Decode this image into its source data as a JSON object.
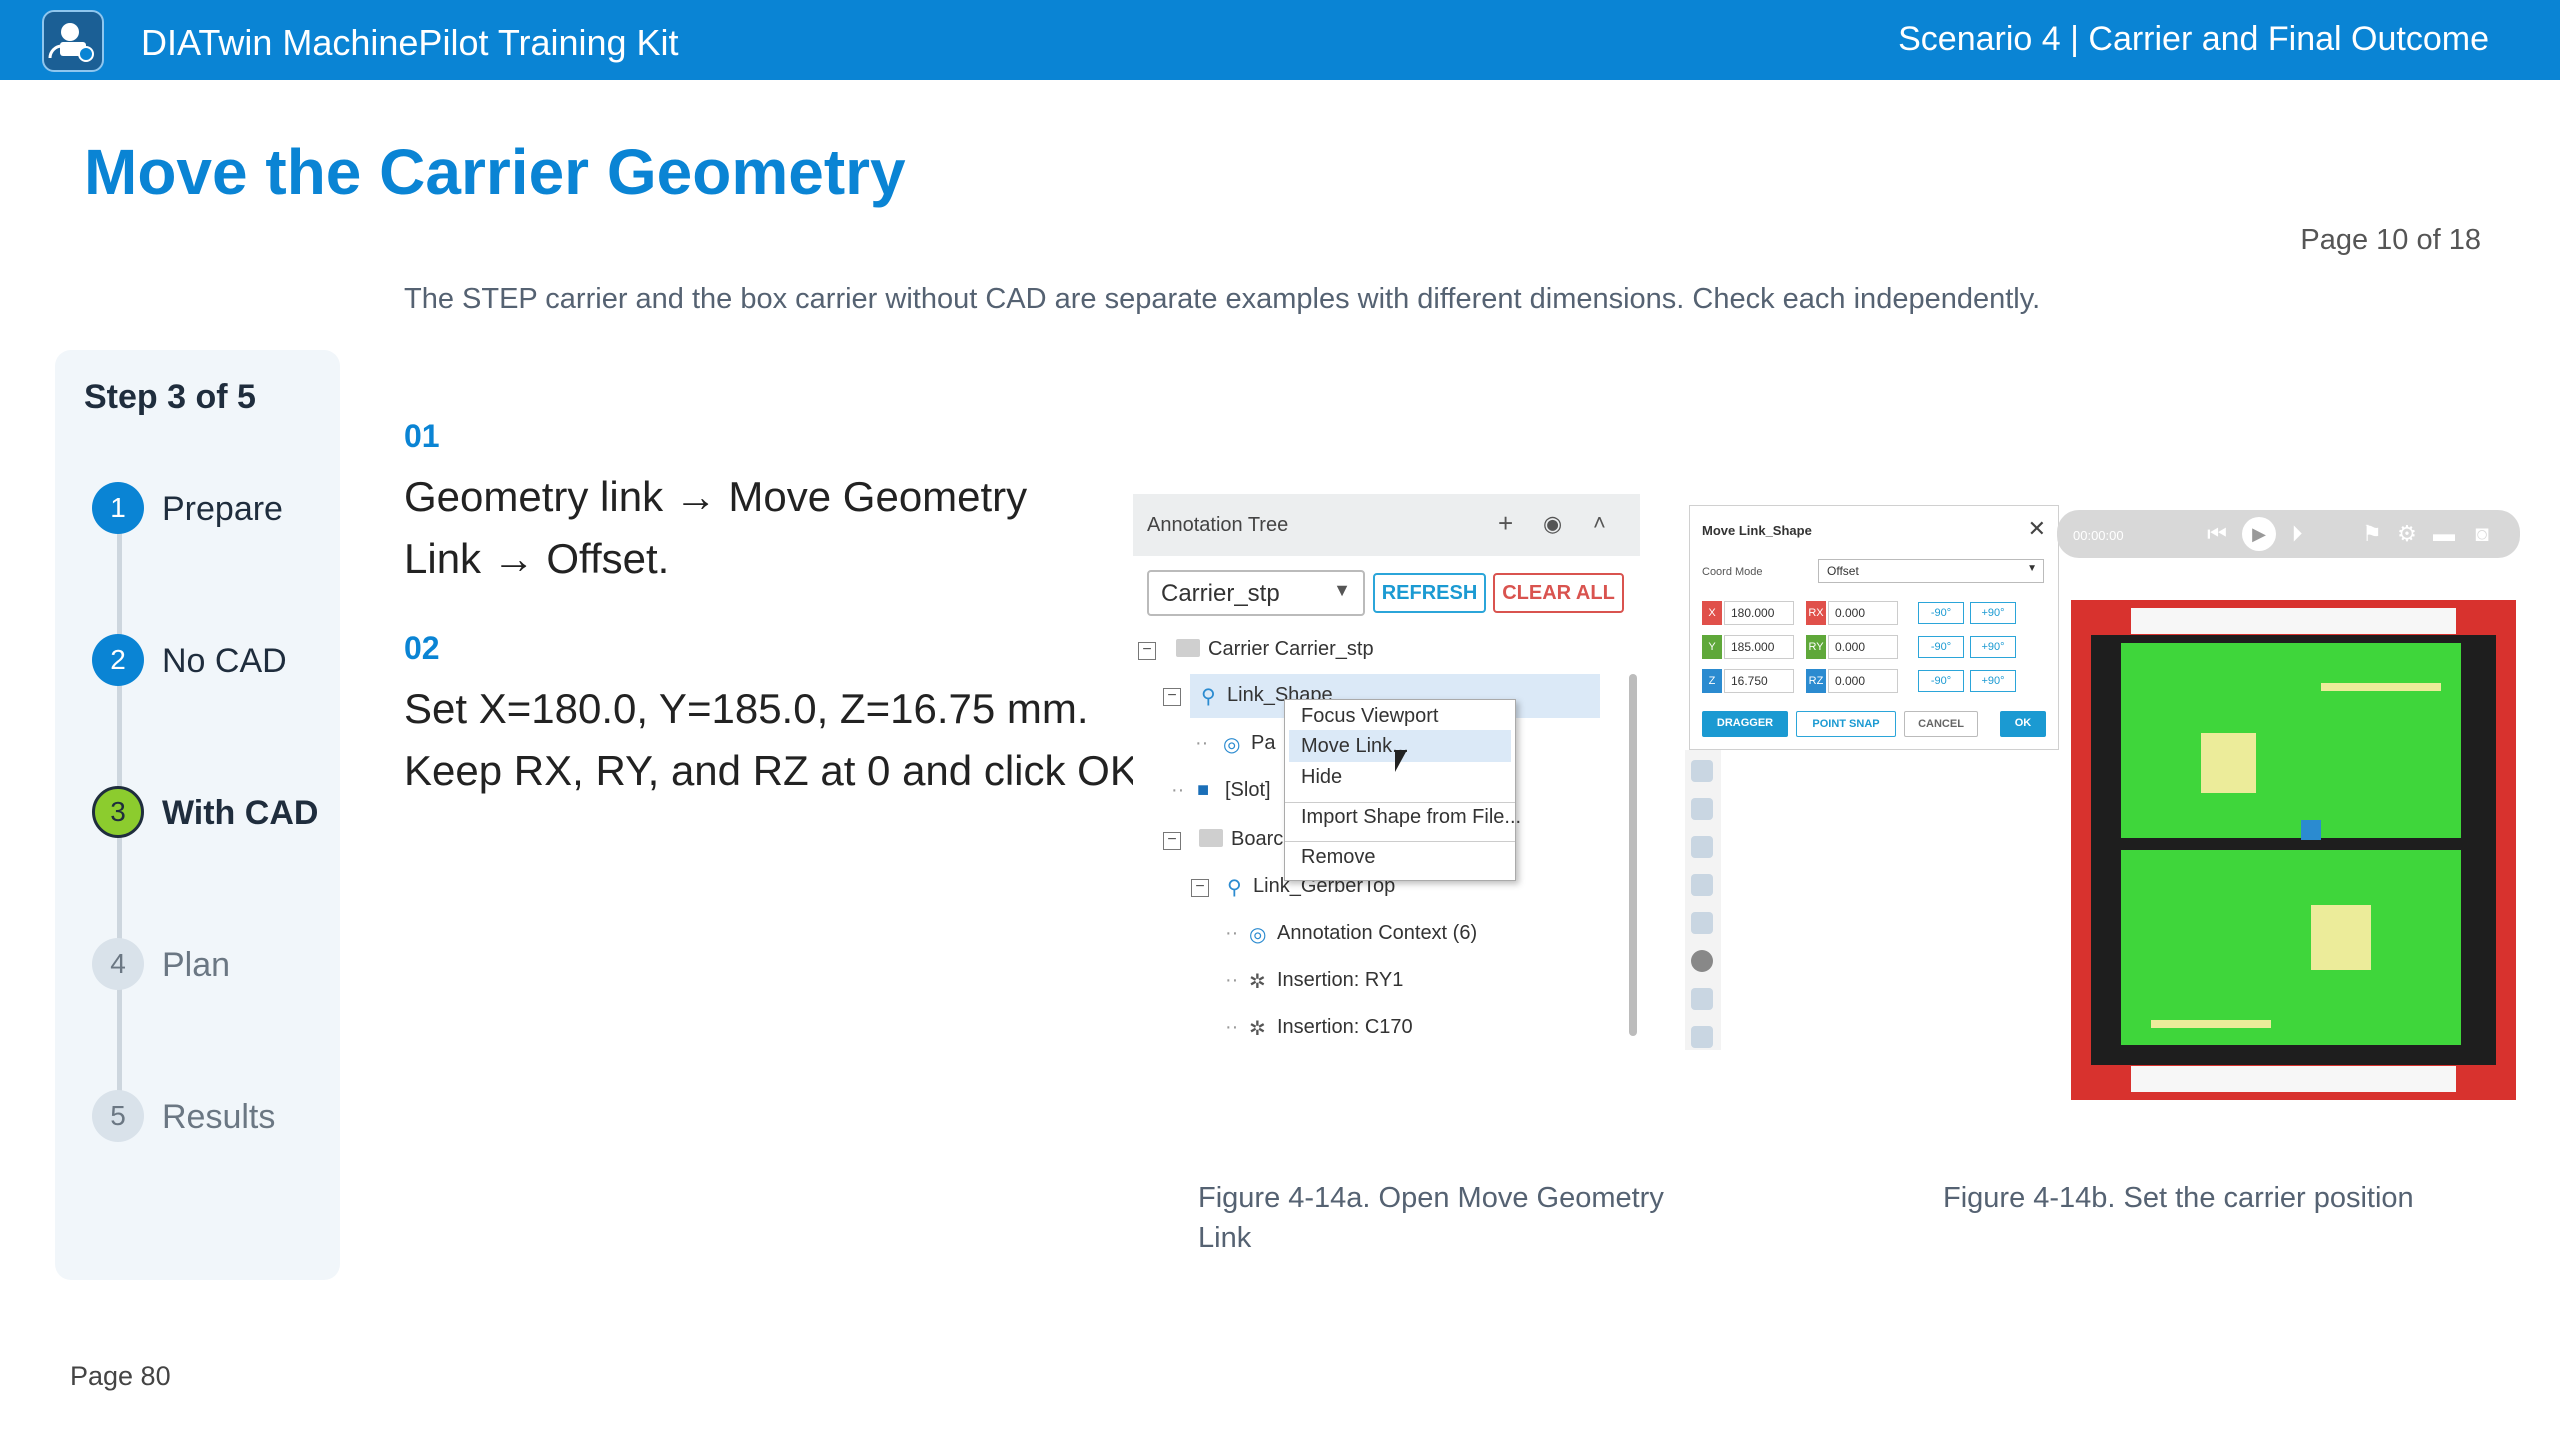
{
  "header": {
    "app_title": "DIATwin MachinePilot Training Kit",
    "scenario": "Scenario 4 | Carrier and Final Outcome"
  },
  "page": {
    "title": "Move the Carrier Geometry",
    "page_count": "Page 10 of 18",
    "note": "The STEP carrier and the box carrier without CAD are separate examples with different dimensions. Check each independently.",
    "footer": "Page 80"
  },
  "stepper": {
    "heading": "Step 3 of 5",
    "steps": [
      {
        "num": "1",
        "label": "Prepare",
        "state": "done"
      },
      {
        "num": "2",
        "label": "No CAD",
        "state": "done"
      },
      {
        "num": "3",
        "label": "With CAD",
        "state": "current"
      },
      {
        "num": "4",
        "label": "Plan",
        "state": "todo"
      },
      {
        "num": "5",
        "label": "Results",
        "state": "todo"
      }
    ]
  },
  "instructions": [
    {
      "num": "01",
      "line1": "Geometry link → Move Geometry",
      "line2": "Link → Offset."
    },
    {
      "num": "02",
      "line1": "Set X=180.0, Y=185.0, Z=16.75 mm.",
      "line2": "Keep RX, RY, and RZ at 0 and click OK."
    }
  ],
  "figure_a": {
    "panel_title": "Annotation Tree",
    "dropdown_value": "Carrier_stp",
    "refresh_label": "REFRESH",
    "clear_all_label": "CLEAR ALL",
    "tree": {
      "carrier": "Carrier  Carrier_stp",
      "link_shape": "Link_Shape",
      "pa": "Pa",
      "slot": "[Slot]",
      "board": "Boarc",
      "link_gerber": "Link_GerberTop",
      "annotation_context": "Annotation Context (6)",
      "insertion_ry1": "Insertion: RY1",
      "insertion_c170": "Insertion: C170"
    },
    "context_menu": [
      "Focus Viewport",
      "Move Link...",
      "Hide",
      "Import Shape from File...",
      "Remove"
    ],
    "caption_line1": "Figure 4-14a. Open Move Geometry",
    "caption_line2": "Link"
  },
  "figure_b": {
    "dialog_title": "Move Link_Shape",
    "coord_mode_label": "Coord Mode",
    "coord_mode_value": "Offset",
    "x": "180.000",
    "y": "185.000",
    "z": "16.750",
    "rx": "0.000",
    "ry": "0.000",
    "rz": "0.000",
    "tag_x": "X",
    "tag_y": "Y",
    "tag_z": "Z",
    "tag_rx": "RX",
    "tag_ry": "RY",
    "tag_rz": "RZ",
    "minus90": "-90°",
    "plus90": "+90°",
    "dragger_label": "DRAGGER",
    "point_snap_label": "POINT SNAP",
    "cancel_label": "CANCEL",
    "ok_label": "OK",
    "player_time": "00:00:00",
    "caption": "Figure 4-14b. Set the carrier position"
  }
}
